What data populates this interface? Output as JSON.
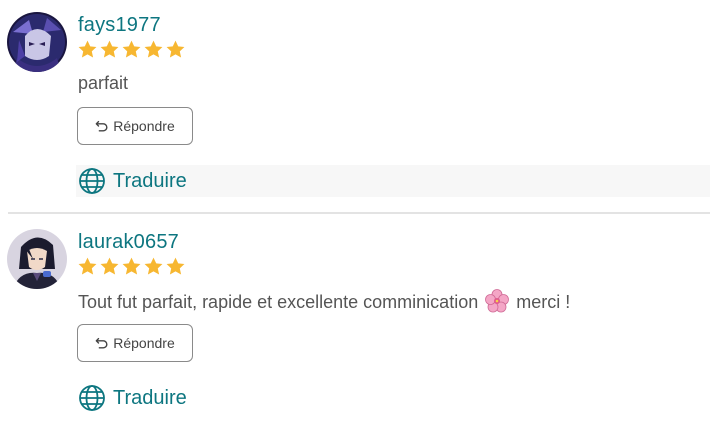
{
  "colors": {
    "accent": "#0d7680",
    "star": "#f7b731",
    "divider": "#e3e3e3"
  },
  "reviews": [
    {
      "username": "fays1977",
      "rating": 5,
      "comment_before": "parfait",
      "comment_after": "",
      "emoji": "",
      "reply_label": "Répondre",
      "translate_label": "Traduire",
      "avatar_icon": "avatar-dark-character"
    },
    {
      "username": "laurak0657",
      "rating": 5,
      "comment_before": "Tout fut parfait, rapide et excellente comminication",
      "comment_after": "merci !",
      "emoji": "cherry-blossom",
      "reply_label": "Répondre",
      "translate_label": "Traduire",
      "avatar_icon": "avatar-anime-character"
    }
  ]
}
